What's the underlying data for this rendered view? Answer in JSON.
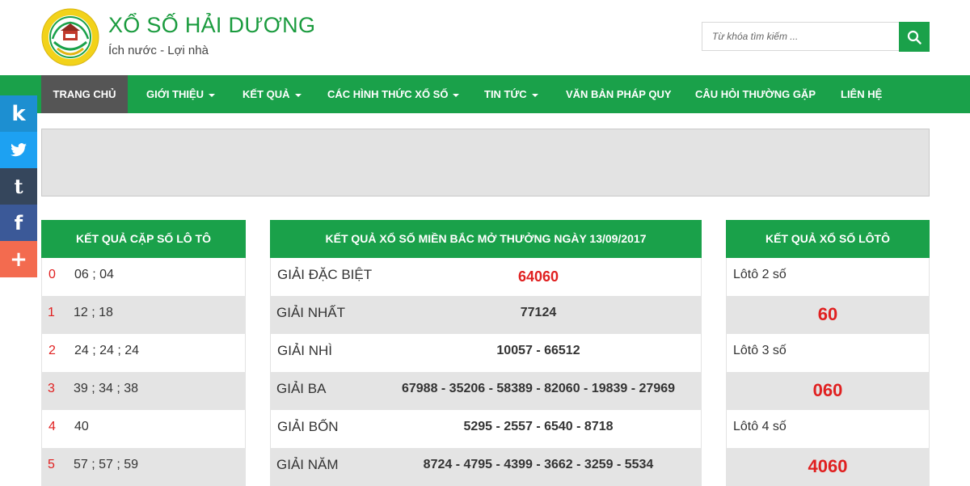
{
  "header": {
    "title": "XỔ SỐ HẢI DƯƠNG",
    "slogan": "Ích nước - Lợi nhà",
    "search_placeholder": "Từ khóa tìm kiếm ..."
  },
  "nav": {
    "items": [
      {
        "label": "Trang chủ",
        "dropdown": false,
        "active": true
      },
      {
        "label": "Giới thiệu",
        "dropdown": true
      },
      {
        "label": "Kết quả",
        "dropdown": true
      },
      {
        "label": "Các hình thức xổ số",
        "dropdown": true
      },
      {
        "label": "Tin tức",
        "dropdown": true
      },
      {
        "label": "Văn bản pháp quy",
        "dropdown": false
      },
      {
        "label": "Câu hỏi thường gặp",
        "dropdown": false
      },
      {
        "label": "Liên hệ",
        "dropdown": false
      }
    ]
  },
  "social": [
    {
      "icon": "kakao-icon",
      "glyph": "k",
      "color": "#1d8fd1"
    },
    {
      "icon": "twitter-icon",
      "glyph": "",
      "color": "#1da1f2"
    },
    {
      "icon": "tumblr-icon",
      "glyph": "t",
      "color": "#35465c"
    },
    {
      "icon": "facebook-icon",
      "glyph": "f",
      "color": "#3b5998"
    },
    {
      "icon": "more-share-icon",
      "glyph": "+",
      "color": "#f36b4f"
    }
  ],
  "loto_pairs": {
    "title": "Kết quả cặp số lô tô",
    "rows": [
      {
        "index": "0",
        "values": "06 ; 04"
      },
      {
        "index": "1",
        "values": "12 ; 18"
      },
      {
        "index": "2",
        "values": "24 ; 24 ; 24"
      },
      {
        "index": "3",
        "values": "39 ; 34 ; 38"
      },
      {
        "index": "4",
        "values": "40"
      },
      {
        "index": "5",
        "values": "57 ; 57 ; 59"
      }
    ]
  },
  "results": {
    "title": "Kết quả xổ số miền Bắc mở thưởng ngày 13/09/2017",
    "rows": [
      {
        "label": "GIẢI ĐẶC BIỆT",
        "value": "64060",
        "special": true
      },
      {
        "label": "GIẢI NHẤT",
        "value": "77124"
      },
      {
        "label": "GIẢI NHÌ",
        "value": "10057 - 66512"
      },
      {
        "label": "GIẢI BA",
        "value": "67988 - 35206 - 58389 - 82060 - 19839 - 27969"
      },
      {
        "label": "GIẢI BỐN",
        "value": "5295 - 2557 - 6540 - 8718"
      },
      {
        "label": "GIẢI NĂM",
        "value": "8724 - 4795 - 4399 - 3662 - 3259 - 5534"
      }
    ]
  },
  "loto": {
    "title": "Kết quả xổ số lôtô",
    "items": [
      {
        "label": "Lôtô 2 số",
        "number": "60"
      },
      {
        "label": "Lôtô 3 số",
        "number": "060"
      },
      {
        "label": "Lôtô 4 số",
        "number": "4060"
      }
    ]
  },
  "colors": {
    "brand_green": "#1aa14a",
    "active_nav": "#555555",
    "accent_red": "#e02020"
  }
}
